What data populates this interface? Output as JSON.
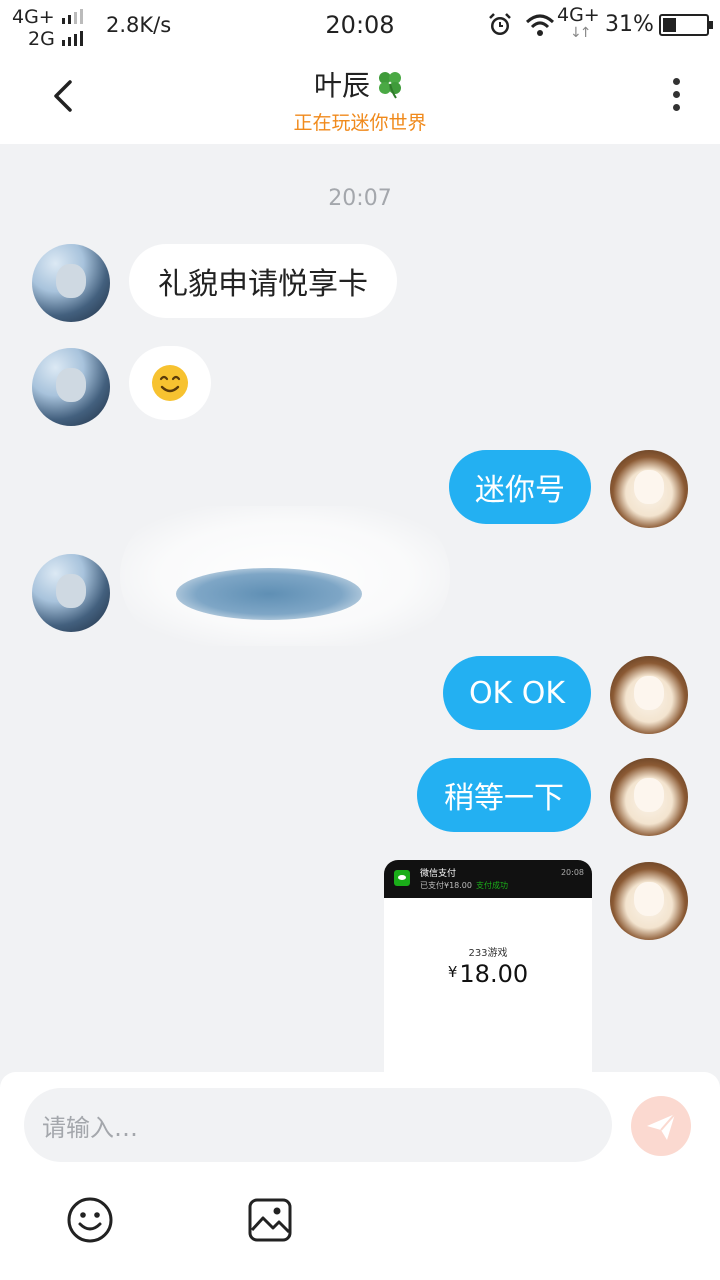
{
  "status_bar": {
    "network_top": "4G+",
    "network_bottom": "2G",
    "speed": "2.8K/s",
    "time": "20:08",
    "network_right": "4G+",
    "battery_percent": "31%",
    "battery_level": 0.31
  },
  "header": {
    "contact_name": "叶辰",
    "contact_status": "正在玩迷你世界",
    "name_icon": "four-leaf-clover-icon"
  },
  "chat": {
    "timestamp": "20:07",
    "messages": [
      {
        "side": "left",
        "type": "text",
        "text": "礼貌申请悦享卡"
      },
      {
        "side": "left",
        "type": "emoji",
        "text": "smiling-face-emoji"
      },
      {
        "side": "right",
        "type": "text",
        "text": "迷你号"
      },
      {
        "side": "left",
        "type": "redacted",
        "text": ""
      },
      {
        "side": "right",
        "type": "text",
        "text": "OK OK"
      },
      {
        "side": "right",
        "type": "text",
        "text": "稍等一下"
      },
      {
        "side": "right",
        "type": "image",
        "text": ""
      }
    ],
    "payment_screenshot": {
      "app_name": "微信支付",
      "paid_text": "已支付¥18.00",
      "status_text": "支付成功",
      "time": "20:08",
      "merchant": "233游戏",
      "currency": "¥",
      "amount": "18.00"
    }
  },
  "input": {
    "placeholder": "请输入…",
    "send_icon": "paper-plane-icon",
    "emoji_icon": "smiley-face-icon",
    "image_icon": "image-icon"
  },
  "colors": {
    "accent": "#23b0f2",
    "status_text": "#f08a1c",
    "background": "#f1f2f4",
    "send_button": "#fbd9d0"
  }
}
